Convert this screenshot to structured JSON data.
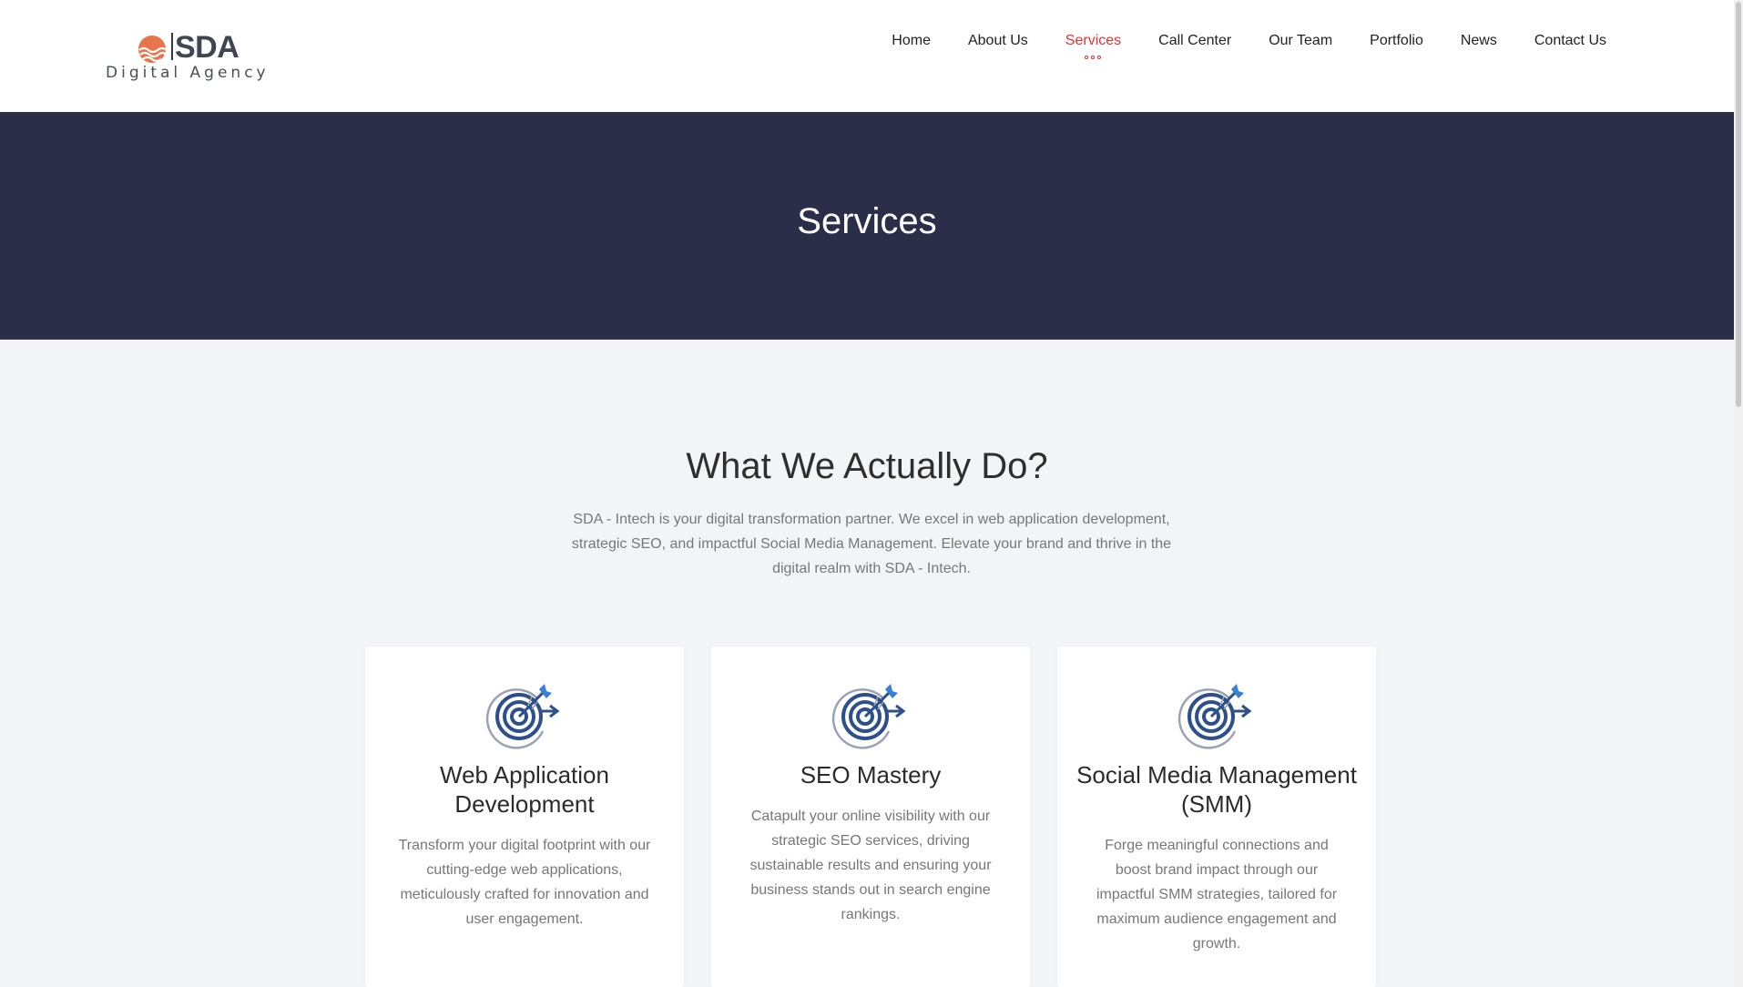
{
  "brand": {
    "name": "SDA",
    "tagline": "Digital Agency",
    "accent": "#e8744a"
  },
  "nav": {
    "items": [
      {
        "label": "Home"
      },
      {
        "label": "About Us"
      },
      {
        "label": "Services",
        "active": true
      },
      {
        "label": "Call Center"
      },
      {
        "label": "Our Team"
      },
      {
        "label": "Portfolio"
      },
      {
        "label": "News"
      },
      {
        "label": "Contact Us"
      }
    ],
    "active_color": "#e0322f"
  },
  "banner": {
    "title": "Services",
    "background": "#2a2e49"
  },
  "intro": {
    "title": "What We Actually Do?",
    "description": "SDA - Intech is your digital transformation partner. We excel in web application development, strategic SEO, and impactful Social Media Management. Elevate your brand and thrive in the digital realm with SDA - Intech."
  },
  "services": [
    {
      "icon": "target-arrow-icon",
      "title": "Web Application Development",
      "text": "Transform your digital footprint with our cutting-edge web applications, meticulously crafted for innovation and user engagement."
    },
    {
      "icon": "target-arrow-icon",
      "title": "SEO Mastery",
      "text": "Catapult your online visibility with our strategic SEO services, driving sustainable results and ensuring your business stands out in search engine rankings."
    },
    {
      "icon": "target-arrow-icon",
      "title": "Social Media Management (SMM)",
      "text": "Forge meaningful connections and boost brand impact through our impactful SMM strategies, tailored for maximum audience engagement and growth."
    }
  ]
}
